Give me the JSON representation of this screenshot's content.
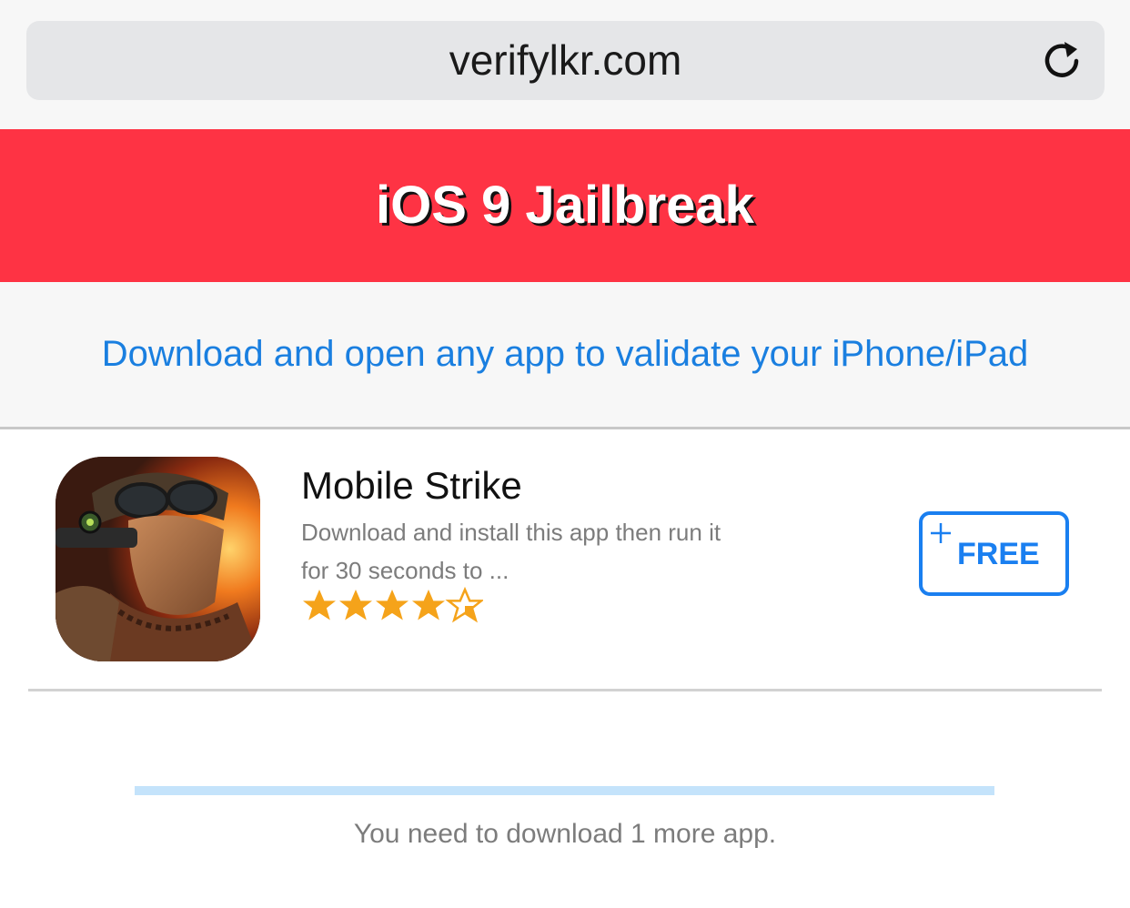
{
  "browser": {
    "url": "verifylkr.com",
    "reload_icon": "reload-icon"
  },
  "header": {
    "title": "iOS 9 Jailbreak",
    "background_color": "#fe3344"
  },
  "instruction": {
    "text": "Download and open any app to validate your iPhone/iPad",
    "color": "#1a7fe0"
  },
  "offers": [
    {
      "icon": "mobile-strike-app-icon",
      "name": "Mobile Strike",
      "description_line1": "Download and install this app then run it",
      "description_line2": "for 30 seconds to ...",
      "rating": 4.5,
      "rating_max": 5,
      "button_label": "FREE",
      "button_icon": "plus-icon"
    }
  ],
  "progress": {
    "fraction": 0,
    "text": "You need to download 1 more app."
  },
  "colors": {
    "accent": "#1a7ff0",
    "star": "#f5a31a",
    "progress_track": "#c4e3fb"
  }
}
